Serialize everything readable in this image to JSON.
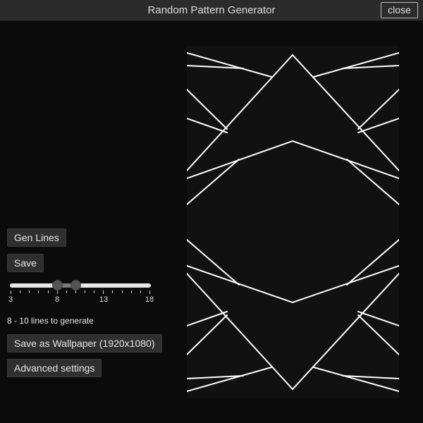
{
  "window": {
    "title": "Random Pattern Generator",
    "close_label": "close"
  },
  "controls": {
    "gen_lines_label": "Gen Lines",
    "save_label": "Save",
    "save_wallpaper_label": "Save as Wallpaper (1920x1080)",
    "advanced_label": "Advanced settings"
  },
  "slider": {
    "min": 3,
    "max": 18,
    "low_value": 8,
    "high_value": 10,
    "tick_labels": [
      "3",
      "8",
      "13",
      "18"
    ]
  },
  "status": {
    "lines_text": "8 - 10 lines to generate"
  },
  "colors": {
    "background": "#0b0b0b",
    "titlebar": "#2b2b2b",
    "canvas": "#111111",
    "line": "#ffffff"
  }
}
